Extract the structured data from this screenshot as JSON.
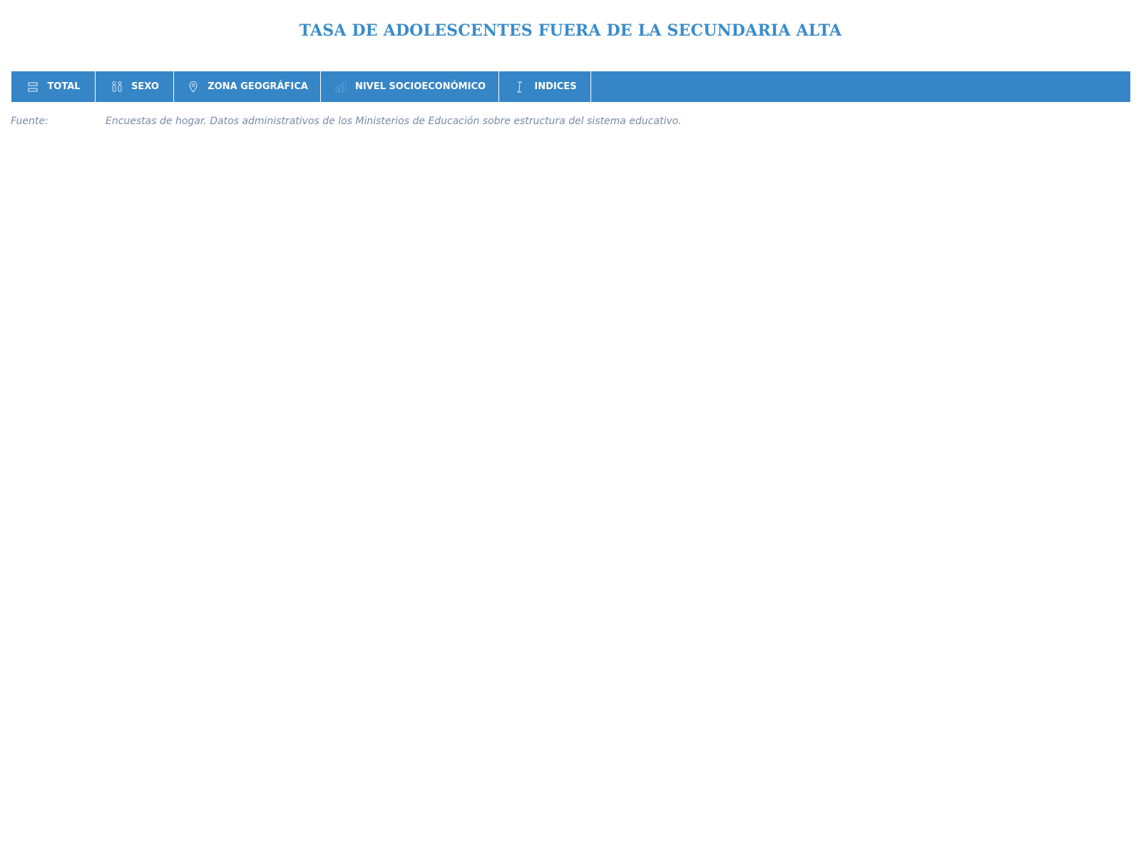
{
  "page": {
    "title": "TASA DE ADOLESCENTES FUERA DE LA SECUNDARIA ALTA"
  },
  "tabs": [
    {
      "label": "TOTAL",
      "icon": "stacked-bars-icon"
    },
    {
      "label": "SEXO",
      "icon": "gender-icon"
    },
    {
      "label": "ZONA GEOGRÁFICA",
      "icon": "map-pin-icon"
    },
    {
      "label": "NIVEL SOCIOECONÓMICO",
      "icon": "levels-icon"
    },
    {
      "label": "INDICES",
      "icon": "index-icon"
    }
  ],
  "source": {
    "label": "Fuente:",
    "text": "Encuestas de hogar. Datos administrativos de los Ministerios de Educación sobre estructura del sistema educativo."
  },
  "colors": {
    "accent": "#3685c6",
    "title": "#3a8ccb",
    "source_text": "#7a8aa6"
  }
}
